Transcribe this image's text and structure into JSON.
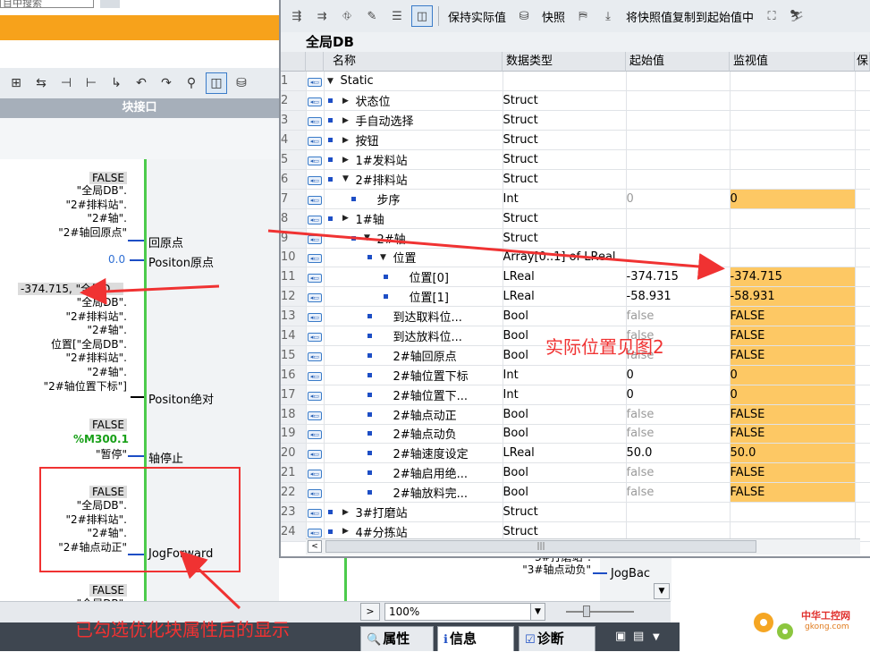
{
  "left_pane": {
    "search_placeholder": "目中搜索",
    "block_interface_label": "块接口",
    "params": [
      {
        "value": "FALSE",
        "lines": "\"全局DB\".\n\"2#排料站\".\n\"2#轴\".\n\"2#轴回原点\"",
        "pin": "回原点"
      },
      {
        "value": "0.0",
        "pin": "Positon原点"
      },
      {
        "value": "-374.715, \"全局D",
        "lines": "\"全局DB\".\n\"2#排料站\".\n\"2#轴\".\n位置[\"全局DB\".\n\"2#排料站\".\n\"2#轴\".\n\"2#轴位置下标\"]",
        "pin": "Positon绝对"
      },
      {
        "value": "FALSE",
        "address": "%M300.1",
        "symbol": "\"暂停\"",
        "pin": "轴停止"
      },
      {
        "value": "FALSE",
        "lines": "\"全局DB\".\n\"2#排料站\".\n\"2#轴\".\n\"2#轴点动正\"",
        "pin": "JogForward"
      },
      {
        "value": "FALSE",
        "lines": "\"全局DB\"."
      }
    ]
  },
  "lower_panel": {
    "line1": "\"3#打磨站\".",
    "line2": "\"3#轴点动负\"",
    "pin": "JogBac"
  },
  "db_window": {
    "toolbar": {
      "keep_actual": "保持实际值",
      "snapshot": "快照",
      "copy_snapshot": "将快照值复制到起始值中"
    },
    "title": "全局DB",
    "columns": {
      "name": "名称",
      "type": "数据类型",
      "start": "起始值",
      "monitor": "监视值",
      "retain": "保"
    },
    "rows": [
      {
        "n": "1",
        "name": "Static",
        "type": "",
        "start": "",
        "monitor": ""
      },
      {
        "n": "2",
        "name": "状态位",
        "type": "Struct",
        "start": "",
        "monitor": ""
      },
      {
        "n": "3",
        "name": "手自动选择",
        "type": "Struct",
        "start": "",
        "monitor": ""
      },
      {
        "n": "4",
        "name": "按钮",
        "type": "Struct",
        "start": "",
        "monitor": ""
      },
      {
        "n": "5",
        "name": "1#发料站",
        "type": "Struct",
        "start": "",
        "monitor": ""
      },
      {
        "n": "6",
        "name": "2#排料站",
        "type": "Struct",
        "start": "",
        "monitor": ""
      },
      {
        "n": "7",
        "name": "步序",
        "type": "Int",
        "start": "0",
        "monitor": "0"
      },
      {
        "n": "8",
        "name": "1#轴",
        "type": "Struct",
        "start": "",
        "monitor": ""
      },
      {
        "n": "9",
        "name": "2#轴",
        "type": "Struct",
        "start": "",
        "monitor": ""
      },
      {
        "n": "10",
        "name": "位置",
        "type": "Array[0..1] of LReal",
        "start": "",
        "monitor": ""
      },
      {
        "n": "11",
        "name": "位置[0]",
        "type": "LReal",
        "start": "-374.715",
        "monitor": "-374.715"
      },
      {
        "n": "12",
        "name": "位置[1]",
        "type": "LReal",
        "start": "-58.931",
        "monitor": "-58.931"
      },
      {
        "n": "13",
        "name": "到达取料位...",
        "type": "Bool",
        "start": "false",
        "monitor": "FALSE"
      },
      {
        "n": "14",
        "name": "到达放料位...",
        "type": "Bool",
        "start": "false",
        "monitor": "FALSE"
      },
      {
        "n": "15",
        "name": "2#轴回原点",
        "type": "Bool",
        "start": "false",
        "monitor": "FALSE"
      },
      {
        "n": "16",
        "name": "2#轴位置下标",
        "type": "Int",
        "start": "0",
        "monitor": "0"
      },
      {
        "n": "17",
        "name": "2#轴位置下...",
        "type": "Int",
        "start": "0",
        "monitor": "0"
      },
      {
        "n": "18",
        "name": "2#轴点动正",
        "type": "Bool",
        "start": "false",
        "monitor": "FALSE"
      },
      {
        "n": "19",
        "name": "2#轴点动负",
        "type": "Bool",
        "start": "false",
        "monitor": "FALSE"
      },
      {
        "n": "20",
        "name": "2#轴速度设定",
        "type": "LReal",
        "start": "50.0",
        "monitor": "50.0"
      },
      {
        "n": "21",
        "name": "2#轴启用绝...",
        "type": "Bool",
        "start": "false",
        "monitor": "FALSE"
      },
      {
        "n": "22",
        "name": "2#轴放料完...",
        "type": "Bool",
        "start": "false",
        "monitor": "FALSE"
      },
      {
        "n": "23",
        "name": "3#打磨站",
        "type": "Struct",
        "start": "",
        "monitor": ""
      },
      {
        "n": "24",
        "name": "4#分拣站",
        "type": "Struct",
        "start": "",
        "monitor": ""
      }
    ]
  },
  "annotations": {
    "actual_position": "实际位置见图2",
    "optimized_display": "已勾选优化块属性后的显示"
  },
  "bottom": {
    "zoom": "100%",
    "tab_properties": "属性",
    "tab_info": "信息",
    "tab_diagnostics": "诊断"
  },
  "logo": {
    "name": "中华工控网",
    "url": "gkong.com"
  },
  "colors": {
    "orange_accent": "#f7a21b",
    "monitor_highlight": "#fdc864",
    "annotation_red": "#f03232",
    "power_rail_green": "#4ccb4c"
  }
}
